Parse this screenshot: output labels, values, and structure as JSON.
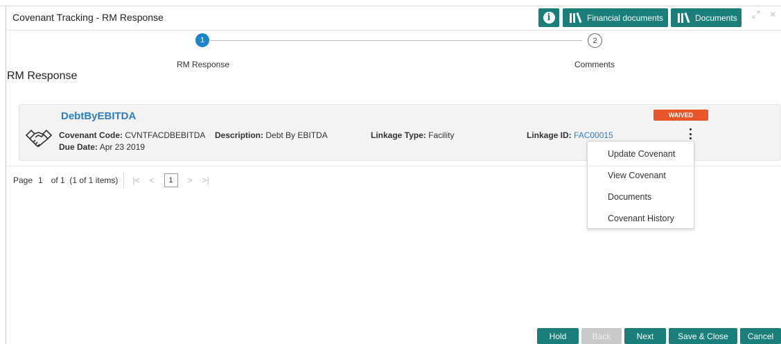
{
  "window": {
    "title": "Covenant Tracking - RM Response"
  },
  "header_buttons": {
    "financial_documents": "Financial documents",
    "documents": "Documents"
  },
  "stepper": {
    "steps": [
      {
        "number": "1",
        "label": "RM Response"
      },
      {
        "number": "2",
        "label": "Comments"
      }
    ]
  },
  "section_title": "RM Response",
  "card": {
    "title": "DebtByEBITDA",
    "covenant_code_label": "Covenant Code:",
    "covenant_code_value": "CVNTFACDBEBITDA",
    "due_date_label": "Due Date:",
    "due_date_value": "Apr 23 2019",
    "description_label": "Description:",
    "description_value": "Debt By EBITDA",
    "linkage_type_label": "Linkage Type:",
    "linkage_type_value": "Facility",
    "linkage_id_label": "Linkage ID:",
    "linkage_id_value": "FAC00015",
    "status_badge": "WAIVED",
    "status_color": "#e8562a"
  },
  "context_menu": {
    "items": [
      "Update Covenant",
      "View Covenant",
      "Documents",
      "Covenant History"
    ]
  },
  "pagination": {
    "page_label": "Page",
    "page_value": "1",
    "of_text": "of 1  (1 of 1 items)",
    "current": "1"
  },
  "footer_buttons": {
    "hold": "Hold",
    "back": "Back",
    "next": "Next",
    "save_close": "Save & Close",
    "cancel": "Cancel"
  },
  "accent_color": "#1a7f7a"
}
